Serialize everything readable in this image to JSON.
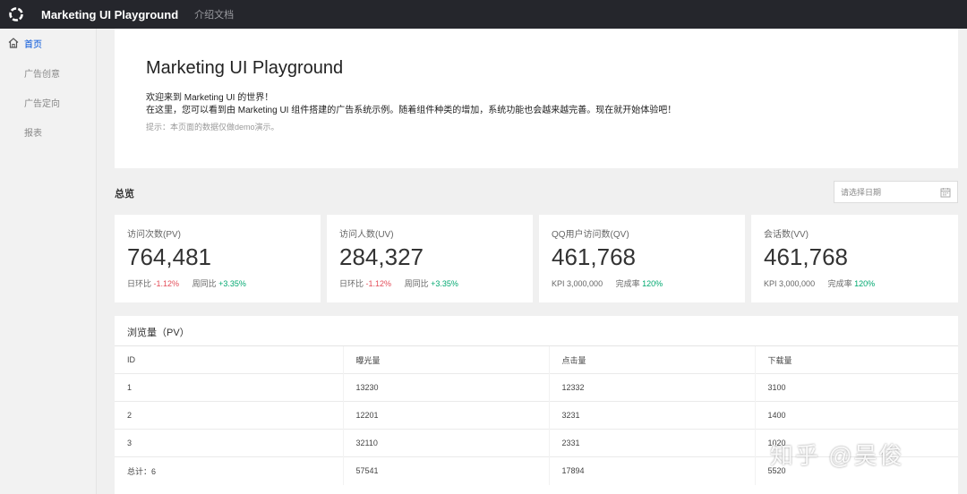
{
  "topbar": {
    "title": "Marketing UI Playground",
    "doc_link": "介绍文档"
  },
  "sidebar": {
    "items": [
      {
        "label": "首页",
        "icon": "home-icon",
        "active": true
      },
      {
        "label": "广告创意"
      },
      {
        "label": "广告定向"
      },
      {
        "label": "报表"
      }
    ]
  },
  "welcome": {
    "title": "Marketing UI Playground",
    "line1": "欢迎来到 Marketing UI 的世界！",
    "line2": "在这里，您可以看到由 Marketing UI 组件搭建的广告系统示例。随着组件种类的增加，系统功能也会越来越完善。现在就开始体验吧！",
    "tip": "提示：本页面的数据仅做demo演示。"
  },
  "overview": {
    "label": "总览",
    "date_placeholder": "请选择日期"
  },
  "cards": [
    {
      "caption": "访问次数(PV)",
      "value": "764,481",
      "m1_label": "日环比",
      "m1_value": "-1.12%",
      "m2_label": "周同比",
      "m2_value": "+3.35%"
    },
    {
      "caption": "访问人数(UV)",
      "value": "284,327",
      "m1_label": "日环比",
      "m1_value": "-1.12%",
      "m2_label": "周同比",
      "m2_value": "+3.35%"
    },
    {
      "caption": "QQ用户访问数(QV)",
      "value": "461,768",
      "m1_label": "KPI",
      "m1_value": "3,000,000",
      "m2_label": "完成率",
      "m2_value": "120%"
    },
    {
      "caption": "会话数(VV)",
      "value": "461,768",
      "m1_label": "KPI",
      "m1_value": "3,000,000",
      "m2_label": "完成率",
      "m2_value": "120%"
    }
  ],
  "table": {
    "title": "浏览量（PV）",
    "headers": [
      "ID",
      "曝光量",
      "点击量",
      "下载量"
    ],
    "rows": [
      [
        "1",
        "13230",
        "12332",
        "3100"
      ],
      [
        "2",
        "12201",
        "3231",
        "1400"
      ],
      [
        "3",
        "32110",
        "2331",
        "1020"
      ],
      [
        "总计：6",
        "57541",
        "17894",
        "5520"
      ]
    ]
  },
  "watermark": "知乎 @吴俊",
  "colors": {
    "topbar": "#25262c",
    "accent": "#0052d9",
    "negative": "#e34d59",
    "positive": "#00a870"
  }
}
